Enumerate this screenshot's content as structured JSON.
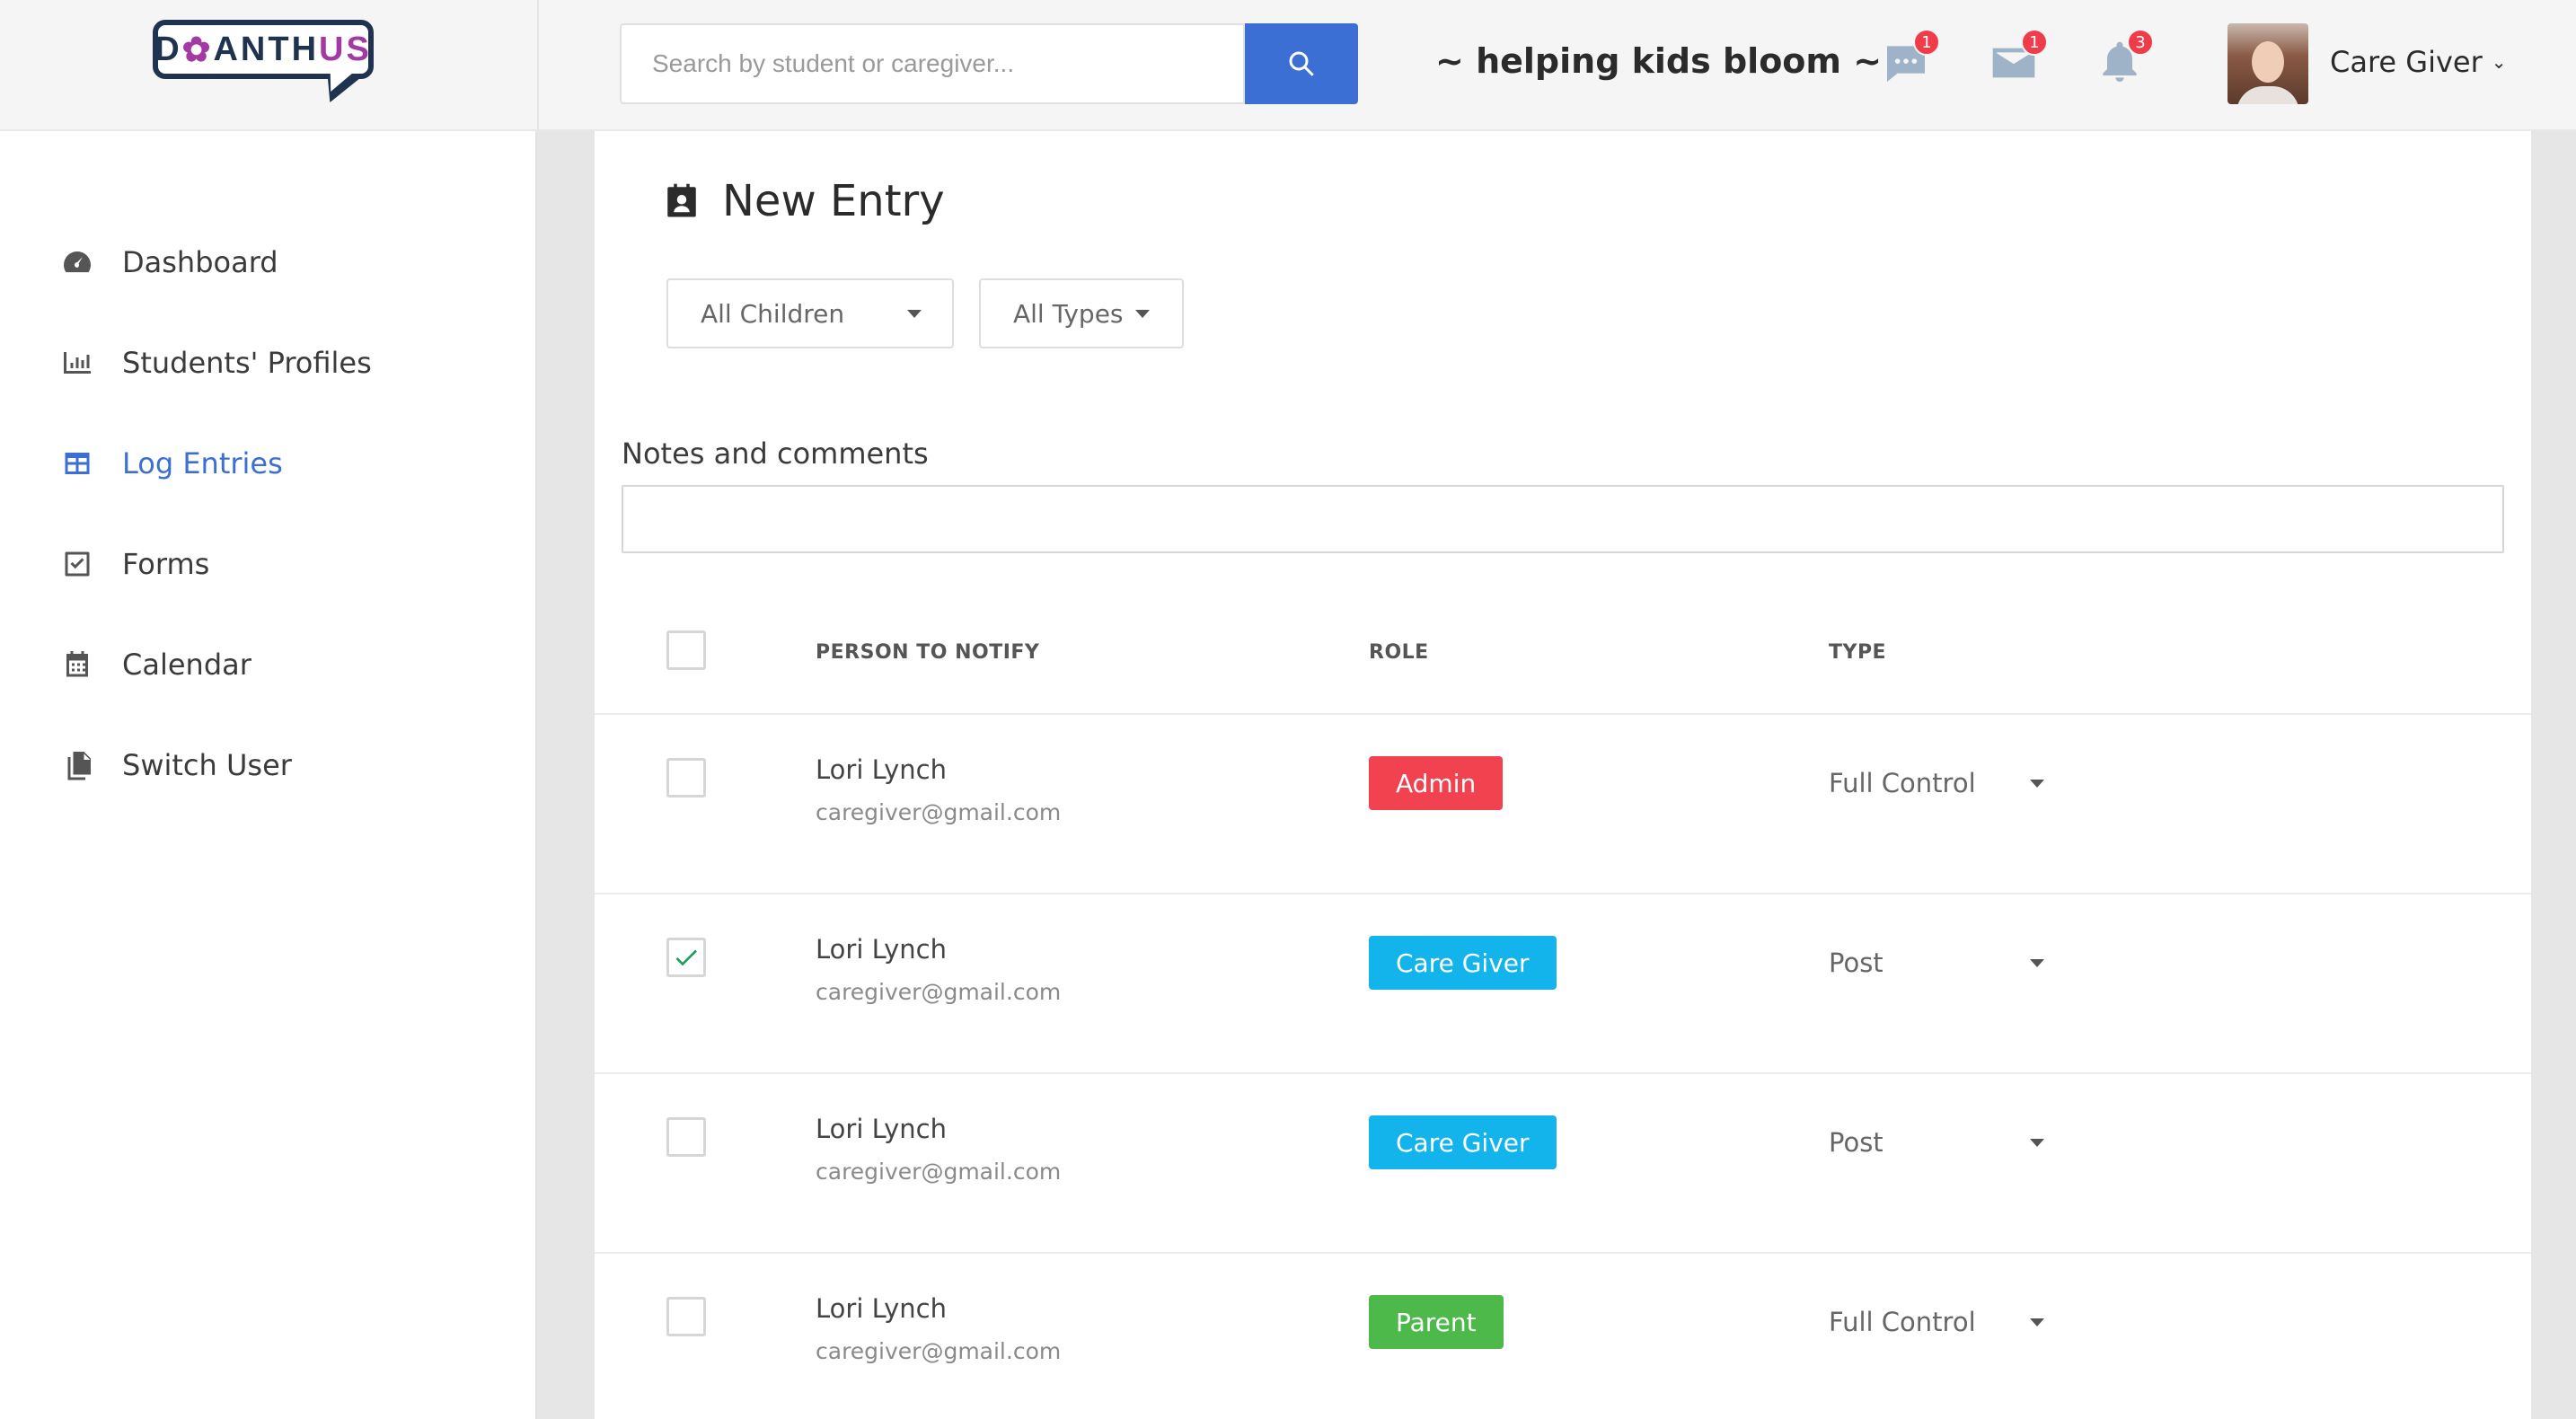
{
  "brand": {
    "logo_left": "D",
    "logo_mark": "✿",
    "logo_mid": "ANTH",
    "logo_right": "US",
    "tagline": "~ helping kids bloom ~",
    "accent_color": "#3b6fd4"
  },
  "search": {
    "placeholder": "Search by student or caregiver..."
  },
  "header": {
    "chat_badge": "1",
    "mail_badge": "1",
    "bell_badge": "3",
    "user_name": "Care Giver"
  },
  "sidebar": {
    "items": [
      {
        "label": "Dashboard",
        "icon": "speedometer-icon",
        "active": false
      },
      {
        "label": "Students' Profiles",
        "icon": "bar-chart-icon",
        "active": false
      },
      {
        "label": "Log Entries",
        "icon": "table-icon",
        "active": true
      },
      {
        "label": "Forms",
        "icon": "checkbox-icon",
        "active": false
      },
      {
        "label": "Calendar",
        "icon": "calendar-icon",
        "active": false
      },
      {
        "label": "Switch User",
        "icon": "documents-icon",
        "active": false
      }
    ]
  },
  "main": {
    "title": "New Entry",
    "filter_children": "All Children",
    "filter_types": "All Types",
    "notes_label": "Notes and comments",
    "table": {
      "headers": {
        "person": "PERSON TO NOTIFY",
        "role": "ROLE",
        "type": "TYPE"
      },
      "rows": [
        {
          "name": "Lori Lynch",
          "email": "caregiver@gmail.com",
          "role": "Admin",
          "role_color": "#f2414f",
          "type": "Full Control",
          "checked": false
        },
        {
          "name": "Lori Lynch",
          "email": "caregiver@gmail.com",
          "role": "Care Giver",
          "role_color": "#13b4ec",
          "type": "Post",
          "checked": true
        },
        {
          "name": "Lori Lynch",
          "email": "caregiver@gmail.com",
          "role": "Care Giver",
          "role_color": "#13b4ec",
          "type": "Post",
          "checked": false
        },
        {
          "name": "Lori Lynch",
          "email": "caregiver@gmail.com",
          "role": "Parent",
          "role_color": "#4cb94a",
          "type": "Full Control",
          "checked": false
        }
      ]
    }
  }
}
